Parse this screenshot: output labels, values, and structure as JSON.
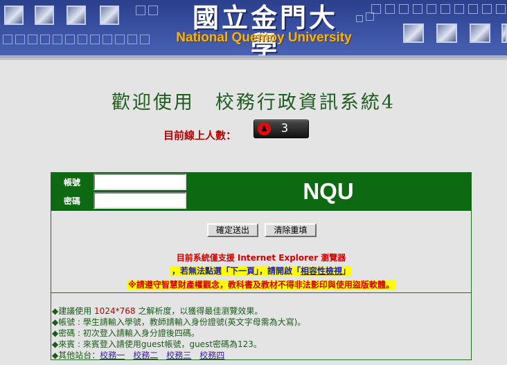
{
  "banner": {
    "logo_chinese": "國立金門大學",
    "logo_english": "National Quemoy University"
  },
  "welcome": {
    "title": "歡迎使用　校務行政資訊系統4",
    "online_label": "目前線上人數：",
    "online_count": "3"
  },
  "login": {
    "account_label": "帳號",
    "password_label": "密碼",
    "account_value": "",
    "password_value": "",
    "brand": "NQU",
    "submit_label": "確定送出",
    "reset_label": "清除重填"
  },
  "notices": {
    "browser_support": "目前系統僅支援 Internet Explorer 瀏覽器",
    "compat_prefix": "，若無法點選「下一頁」，請開啟「",
    "compat_link": "相容性檢視",
    "compat_suffix": "」",
    "ip_warning": "※請遵守智慧財產權觀念，教科書及教材不得非法影印與使用盜版軟體。"
  },
  "info": {
    "resolution_prefix": "◆建議使用 ",
    "resolution_value": "1024*768",
    "resolution_suffix": " 之解析度，以獲得最佳瀏覽效果。",
    "account_tip": "◆帳號 : 學生請輸入學號，教師請輸入身份證號(英文字母需為大寫)。",
    "password_tip": "◆密碼 : 初次登入請輸入身分證後四碼。",
    "guest_tip": "◆來賓 : 來賓登入請使用guest帳號，guest密碼為123。",
    "other_sites_label": "◆其他站台：",
    "other_sites": [
      "校務一",
      "校務二",
      "校務三",
      "校務四"
    ]
  },
  "colors": {
    "banner_blue": "#2b3f8c",
    "login_green": "#0d6a12",
    "title_green": "#1f5b1f",
    "alert_red": "#b00000",
    "highlight_yellow": "#ffff00",
    "link_purple": "#3a1aa8"
  }
}
